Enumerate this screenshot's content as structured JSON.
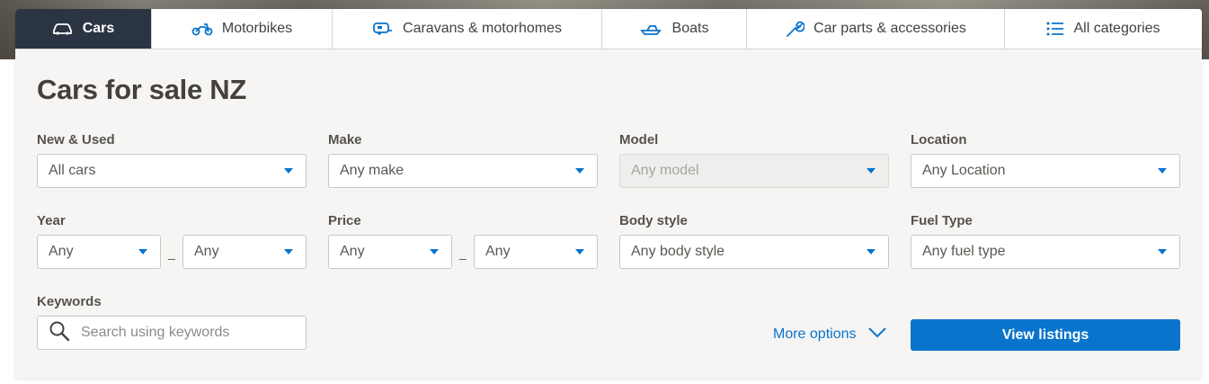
{
  "tabs": [
    {
      "label": "Cars",
      "icon": "car-icon",
      "active": true
    },
    {
      "label": "Motorbikes",
      "icon": "motorbike-icon"
    },
    {
      "label": "Caravans & motorhomes",
      "icon": "caravan-icon"
    },
    {
      "label": "Boats",
      "icon": "boat-icon"
    },
    {
      "label": "Car parts & accessories",
      "icon": "wrench-icon"
    },
    {
      "label": "All categories",
      "icon": "list-icon"
    }
  ],
  "page_title": "Cars for sale NZ",
  "filters": {
    "new_used": {
      "label": "New & Used",
      "value": "All cars"
    },
    "make": {
      "label": "Make",
      "value": "Any make"
    },
    "model": {
      "label": "Model",
      "value": "Any model",
      "disabled": true
    },
    "location": {
      "label": "Location",
      "value": "Any Location"
    },
    "year": {
      "label": "Year",
      "min": "Any",
      "max": "Any",
      "separator": "_"
    },
    "price": {
      "label": "Price",
      "min": "Any",
      "max": "Any",
      "separator": "_"
    },
    "body_style": {
      "label": "Body style",
      "value": "Any body style"
    },
    "fuel_type": {
      "label": "Fuel Type",
      "value": "Any fuel type"
    }
  },
  "keywords": {
    "label": "Keywords",
    "placeholder": "Search using keywords"
  },
  "more_options_label": "More options",
  "view_listings_label": "View listings",
  "colors": {
    "accent": "#0a74cc",
    "active_tab": "#2b3443",
    "card_bg": "#f6f5f4"
  }
}
